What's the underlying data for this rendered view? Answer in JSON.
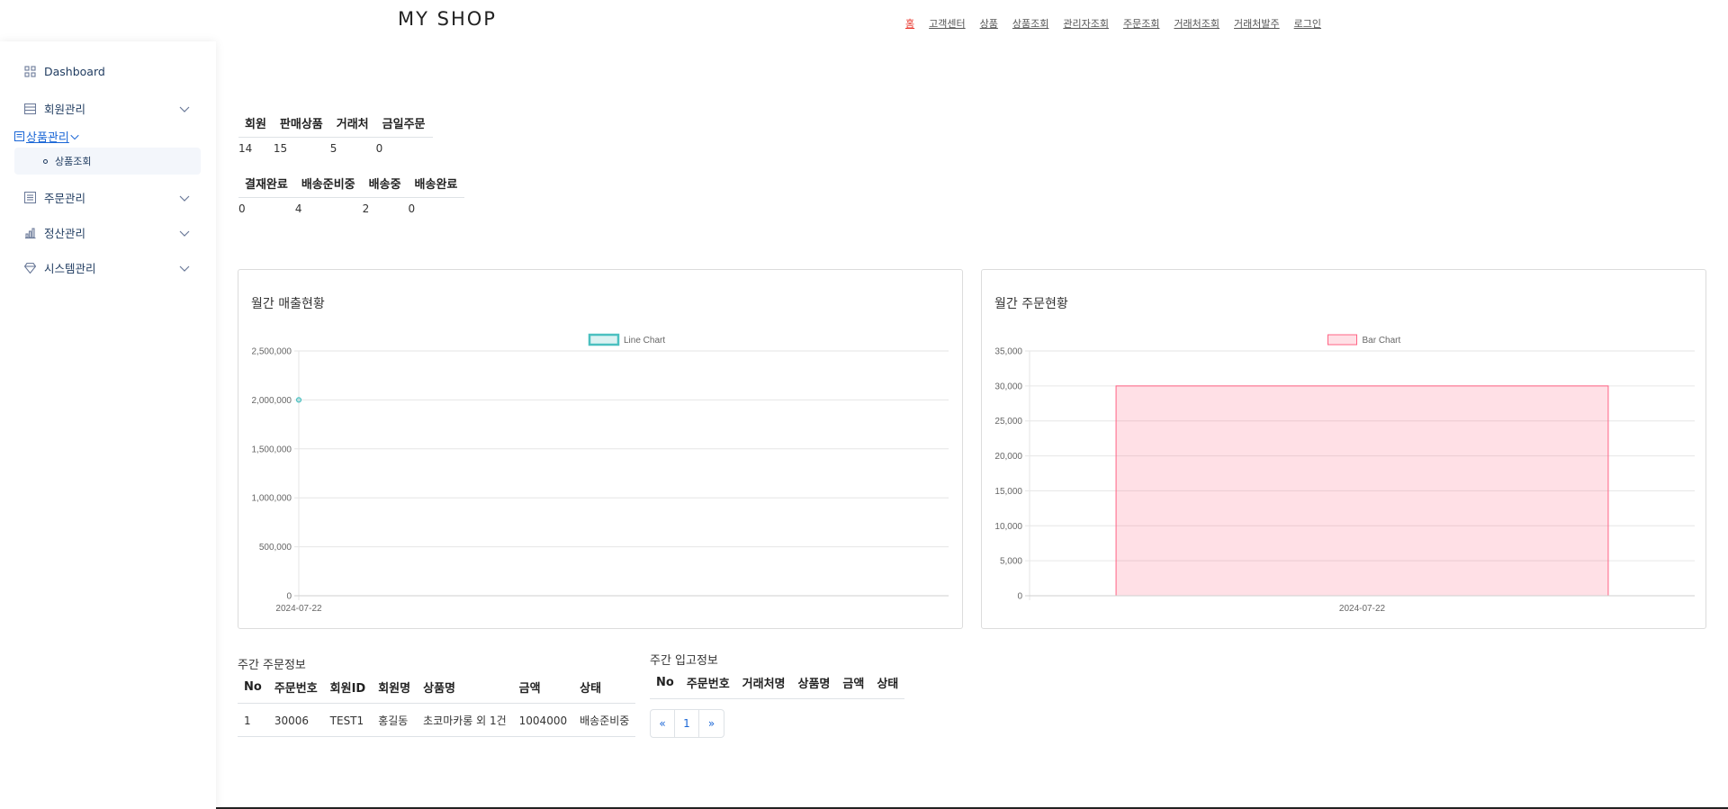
{
  "header": {
    "brand": "MY SHOP",
    "nav": [
      "홈",
      "고객센터",
      "상품",
      "상품조회",
      "관리자조회",
      "주문조회",
      "거래처조회",
      "거래처발주",
      "로그인"
    ]
  },
  "sidebar": {
    "dashboard": "Dashboard",
    "member": "회원관리",
    "product": "상품관리",
    "product_sub": "상품조회",
    "order": "주문관리",
    "settle": "정산관리",
    "system": "시스템관리"
  },
  "stats1": {
    "headers": [
      "회원",
      "판매상품",
      "거래처",
      "금일주문"
    ],
    "values": [
      "14",
      "15",
      "5",
      "0"
    ]
  },
  "stats2": {
    "headers": [
      "결재완료",
      "배송준비중",
      "배송중",
      "배송완료"
    ],
    "values": [
      "0",
      "4",
      "2",
      "0"
    ]
  },
  "sales_card": {
    "title": "월간 매출현황"
  },
  "orders_card": {
    "title": "월간 주문현황"
  },
  "chart_data": [
    {
      "type": "line",
      "title": "월간 매출현황",
      "x": [
        "2024-07-22"
      ],
      "series": [
        {
          "name": "Line Chart",
          "values": [
            2000000
          ]
        }
      ],
      "ylim": [
        0,
        2500000
      ],
      "yticks": [
        "0",
        "500,000",
        "1,000,000",
        "1,500,000",
        "2,000,000",
        "2,500,000"
      ],
      "legend": "top",
      "grid": true,
      "color": "#4bc0c0"
    },
    {
      "type": "bar",
      "title": "월간 주문현황",
      "categories": [
        "2024-07-22"
      ],
      "series": [
        {
          "name": "Bar Chart",
          "values": [
            30000
          ]
        }
      ],
      "ylim": [
        0,
        35000
      ],
      "yticks": [
        "0",
        "5,000",
        "10,000",
        "15,000",
        "20,000",
        "25,000",
        "30,000",
        "35,000"
      ],
      "legend": "top",
      "grid": true,
      "color": "#ff6384"
    }
  ],
  "weekly_orders": {
    "title": "주간 주문정보",
    "headers": [
      "No",
      "주문번호",
      "회원ID",
      "회원명",
      "상품명",
      "금액",
      "상태"
    ],
    "rows": [
      [
        "1",
        "30006",
        "TEST1",
        "홍길동",
        "초코마카롱 외 1건",
        "1004000",
        "배송준비중"
      ]
    ]
  },
  "weekly_stock": {
    "title": "주간 입고정보",
    "headers": [
      "No",
      "주문번호",
      "거래처명",
      "상품명",
      "금액",
      "상태"
    ]
  },
  "pager": {
    "prev": "«",
    "page": "1",
    "next": "»"
  }
}
